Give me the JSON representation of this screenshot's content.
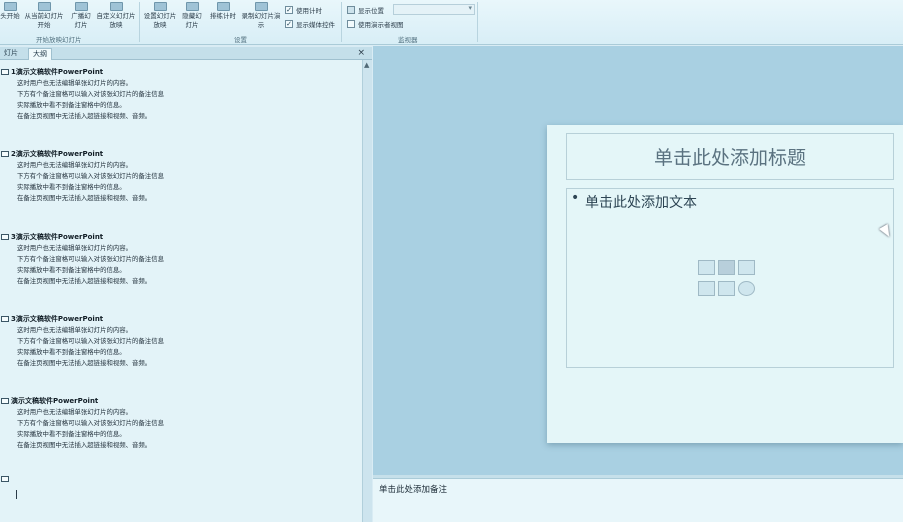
{
  "ribbon": {
    "buttons": [
      {
        "label": "头开始"
      },
      {
        "label": "从当前幻灯片开始"
      },
      {
        "label": "广播幻灯片"
      },
      {
        "label": "自定义幻灯片放映"
      },
      {
        "label": "设置幻灯片放映"
      },
      {
        "label": "隐藏幻灯片"
      },
      {
        "label": "排练计时"
      },
      {
        "label": "录制幻灯片演示"
      }
    ],
    "checkboxes": {
      "use_timing": {
        "label": "使用计时",
        "checked": true
      },
      "show_media_controls": {
        "label": "显示媒体控件",
        "checked": true
      },
      "display_location": {
        "label": "显示位置",
        "checked": false
      },
      "presenter_view": {
        "label": "使用演示者视图",
        "checked": false
      }
    },
    "group_labels": {
      "start": "开始放映幻灯片",
      "setup": "设置",
      "monitors": "监视器"
    }
  },
  "left_pane": {
    "tabs": [
      "灯片",
      "大纲"
    ],
    "active_tab": "大纲",
    "close_glyph": "×",
    "slides": [
      {
        "title": "1演示文稿软件PowerPoint",
        "lines": [
          "这时用户也无法编辑单张幻灯片的内容。",
          "下方有个备注窗格可以输入对该张幻灯片的备注信息",
          "实际播放中看不到备注窗格中的信息。",
          "在备注页视图中无法插入超链接和视频、音频。"
        ]
      },
      {
        "title": "2演示文稿软件PowerPoint",
        "lines": [
          "这时用户也无法编辑单张幻灯片的内容。",
          "下方有个备注窗格可以输入对该张幻灯片的备注信息",
          "实际播放中看不到备注窗格中的信息。",
          "在备注页视图中无法插入超链接和视频、音频。"
        ]
      },
      {
        "title": "3演示文稿软件PowerPoint",
        "lines": [
          "这时用户也无法编辑单张幻灯片的内容。",
          "下方有个备注窗格可以输入对该张幻灯片的备注信息",
          "实际播放中看不到备注窗格中的信息。",
          "在备注页视图中无法插入超链接和视频、音频。"
        ]
      },
      {
        "title": "3演示文稿软件PowerPoint",
        "lines": [
          "这时用户也无法编辑单张幻灯片的内容。",
          "下方有个备注窗格可以输入对该张幻灯片的备注信息",
          "实际播放中看不到备注窗格中的信息。",
          "在备注页视图中无法插入超链接和视频、音频。"
        ]
      },
      {
        "title": "演示文稿软件PowerPoint",
        "lines": [
          "这时用户也无法编辑单张幻灯片的内容。",
          "下方有个备注窗格可以输入对该张幻灯片的备注信息",
          "实际播放中看不到备注窗格中的信息。",
          "在备注页视图中无法插入超链接和视频、音频。"
        ]
      }
    ]
  },
  "slide": {
    "title_placeholder": "单击此处添加标题",
    "bullet": "•",
    "body_placeholder": "单击此处添加文本"
  },
  "notes": {
    "placeholder": "单击此处添加备注"
  }
}
